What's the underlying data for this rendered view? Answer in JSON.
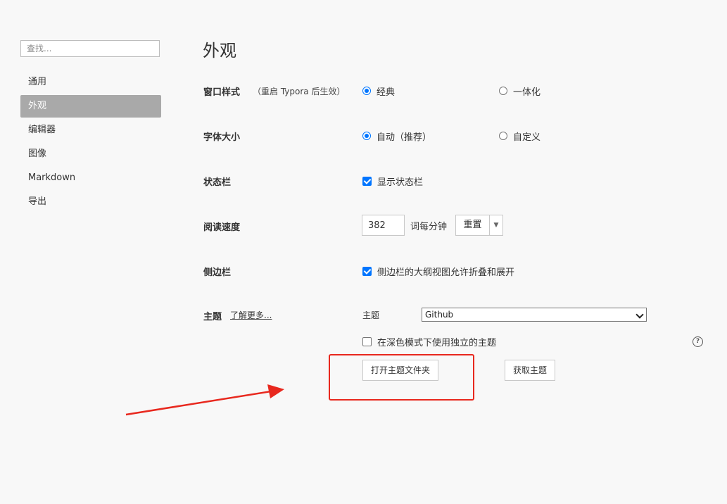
{
  "sidebar": {
    "search_placeholder": "查找...",
    "items": [
      {
        "label": "通用",
        "active": false
      },
      {
        "label": "外观",
        "active": true
      },
      {
        "label": "编辑器",
        "active": false
      },
      {
        "label": "图像",
        "active": false
      },
      {
        "label": "Markdown",
        "active": false
      },
      {
        "label": "导出",
        "active": false
      }
    ]
  },
  "main": {
    "title": "外观",
    "window_style": {
      "label": "窗口样式",
      "hint": "（重启 Typora 后生效）",
      "options": [
        {
          "label": "经典",
          "selected": true
        },
        {
          "label": "一体化",
          "selected": false
        }
      ]
    },
    "font_size": {
      "label": "字体大小",
      "options": [
        {
          "label": "自动（推荐）",
          "selected": true
        },
        {
          "label": "自定义",
          "selected": false
        }
      ]
    },
    "status_bar": {
      "label": "状态栏",
      "checkbox_label": "显示状态栏",
      "checked": true
    },
    "reading_speed": {
      "label": "阅读速度",
      "value": "382",
      "unit": "词每分钟",
      "reset_label": "重置",
      "caret": "▼"
    },
    "sidebar_setting": {
      "label": "侧边栏",
      "checkbox_label": "侧边栏的大纲视图允许折叠和展开",
      "checked": true
    },
    "theme": {
      "label": "主题",
      "learn_more": "了解更多...",
      "select_label": "主题",
      "selected": "Github",
      "dark_mode_label": "在深色模式下使用独立的主题",
      "dark_mode_checked": false,
      "help_glyph": "?",
      "open_folder_label": "打开主题文件夹",
      "get_themes_label": "获取主题"
    }
  },
  "colors": {
    "accent": "#0075ff",
    "active_nav_bg": "#a9a9a9",
    "annotation_red": "#e8281e"
  }
}
